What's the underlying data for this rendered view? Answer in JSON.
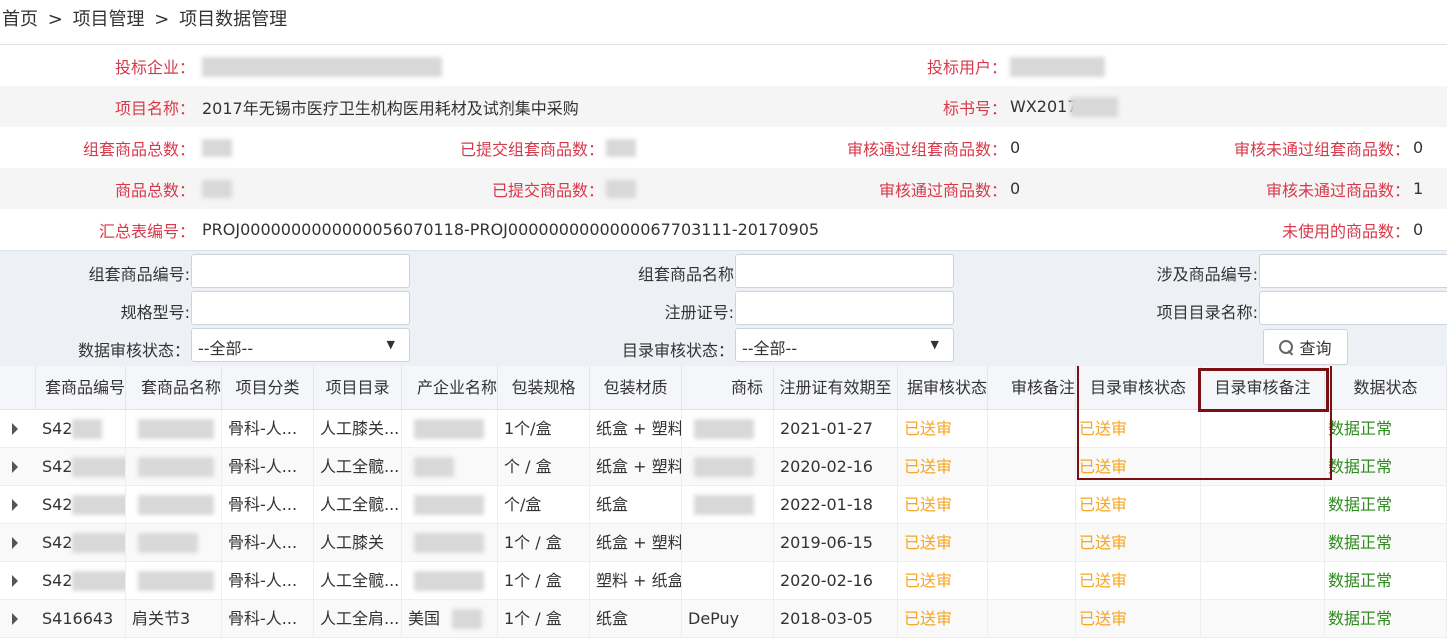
{
  "breadcrumb": [
    "首页",
    ">",
    "项目管理",
    ">",
    "项目数据管理"
  ],
  "info": {
    "bid_company_label": "投标企业：",
    "bid_user_label": "投标用户：",
    "project_name_label": "项目名称：",
    "project_name_value": "2017年无锡市医疗卫生机构医用耗材及试剂集中采购",
    "bid_no_label": "标书号：",
    "bid_no_value": "WX2017",
    "set_total_label": "组套商品总数：",
    "set_submitted_label": "已提交组套商品数：",
    "set_passed_label": "审核通过组套商品数：",
    "set_passed_value": "0",
    "set_failed_label": "审核未通过组套商品数：",
    "set_failed_value": "0",
    "goods_total_label": "商品总数：",
    "goods_submitted_label": "已提交商品数：",
    "goods_passed_label": "审核通过商品数：",
    "goods_passed_value": "0",
    "goods_failed_label": "审核未通过商品数：",
    "goods_failed_value": "1",
    "summary_no_label": "汇总表编号：",
    "summary_no_value": "PROJ0000000000000056070118-PROJ0000000000000067703111-20170905",
    "unused_label": "未使用的商品数：",
    "unused_value": "0"
  },
  "filter": {
    "set_code_label": "组套商品编号:",
    "set_name_label": "组套商品名称",
    "involved_code_label": "涉及商品编号:",
    "spec_label": "规格型号:",
    "reg_no_label": "注册证号:",
    "catalog_name_label": "项目目录名称:",
    "data_audit_label": "数据审核状态：",
    "data_audit_value": "--全部--",
    "catalog_audit_label": "目录审核状态：",
    "catalog_audit_value": "--全部--",
    "query_label": "查询"
  },
  "table": {
    "headers": [
      "套商品编号",
      "套商品名称",
      "项目分类",
      "项目目录",
      "产企业名称",
      "包装规格",
      "包装材质",
      "商标",
      "注册证有效期至",
      "据审核状态",
      "审核备注",
      "目录审核状态",
      "目录审核备注",
      "数据状态"
    ],
    "rows": [
      {
        "code": "S42",
        "name": "",
        "category": "骨科-人...",
        "catalog": "人工膝关...",
        "maker": "",
        "spec": "1个/盒",
        "material": "纸盒 + 塑料",
        "brand": "",
        "expiry": "2021-01-27",
        "data_audit": "已送审",
        "audit_note": "",
        "catalog_audit": "已送审",
        "catalog_note": "",
        "data_status": "数据正常"
      },
      {
        "code": "S42",
        "name": "",
        "category": "骨科-人...",
        "catalog": "人工全髋...",
        "maker": "",
        "spec": "个 / 盒",
        "material": "纸盒 + 塑料",
        "brand": "",
        "expiry": "2020-02-16",
        "data_audit": "已送审",
        "audit_note": "",
        "catalog_audit": "已送审",
        "catalog_note": "",
        "data_status": "数据正常"
      },
      {
        "code": "S42",
        "name": "",
        "category": "骨科-人...",
        "catalog": "人工全髋...",
        "maker": "",
        "spec": "个/盒",
        "material": "纸盒",
        "brand": "",
        "expiry": "2022-01-18",
        "data_audit": "已送审",
        "audit_note": "",
        "catalog_audit": "已送审",
        "catalog_note": "",
        "data_status": "数据正常"
      },
      {
        "code": "S42",
        "name": "",
        "category": "骨科-人...",
        "catalog": "人工膝关",
        "maker": "",
        "spec": "1个 / 盒",
        "material": "纸盒 + 塑料",
        "brand": "",
        "expiry": "2019-06-15",
        "data_audit": "已送审",
        "audit_note": "",
        "catalog_audit": "已送审",
        "catalog_note": "",
        "data_status": "数据正常"
      },
      {
        "code": "S42",
        "name": "",
        "category": "骨科-人...",
        "catalog": "人工全髋...",
        "maker": "",
        "spec": "1个 / 盒",
        "material": "塑料 + 纸盒",
        "brand": "",
        "expiry": "2020-02-16",
        "data_audit": "已送审",
        "audit_note": "",
        "catalog_audit": "已送审",
        "catalog_note": "",
        "data_status": "数据正常"
      },
      {
        "code": "S416643",
        "name": "肩关节3",
        "category": "骨科-人...",
        "catalog": "人工全肩...",
        "maker": "美国",
        "spec": "1个 / 盒",
        "material": "纸盒",
        "brand": "DePuy",
        "expiry": "2018-03-05",
        "data_audit": "已送审",
        "audit_note": "",
        "catalog_audit": "已送审",
        "catalog_note": "",
        "data_status": "数据正常"
      }
    ]
  },
  "colors": {
    "label_red": "#d8394a",
    "status_orange": "#f5a623",
    "status_green": "#2e8b1e",
    "highlight_box": "#7a0f14"
  }
}
